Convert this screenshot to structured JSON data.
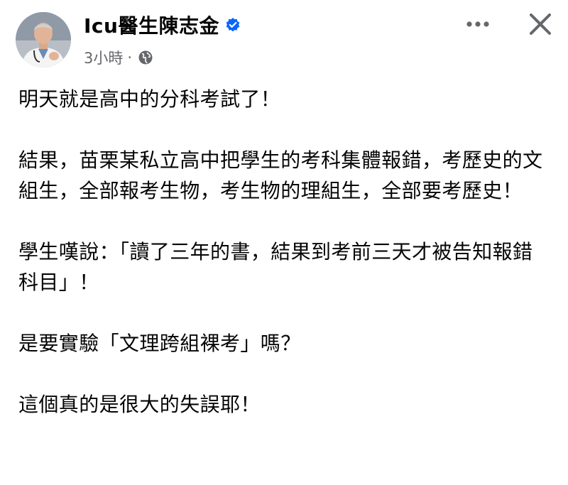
{
  "post": {
    "author_name": "Icu醫生陳志金",
    "timestamp": "3小時",
    "separator": "·",
    "paragraphs": [
      "明天就是高中的分科考試了！",
      "結果，苗栗某私立高中把學生的考科集體報錯，考歷史的文組生，全部報考生物，考生物的理組生，全部要考歷史！",
      "學生嘆說：「讀了三年的書，結果到考前三天才被告知報錯科目」！",
      "是要實驗「文理跨組裸考」嗎？",
      "這個真的是很大的失誤耶！"
    ]
  },
  "icons": {
    "avatar": "avatar-photo",
    "verified": "verified-badge-icon",
    "audience": "globe-icon",
    "more": "more-horizontal-icon",
    "close": "close-icon"
  },
  "colors": {
    "verified_blue": "#0866ff",
    "secondary_text": "#65676b",
    "primary_text": "#050505"
  }
}
